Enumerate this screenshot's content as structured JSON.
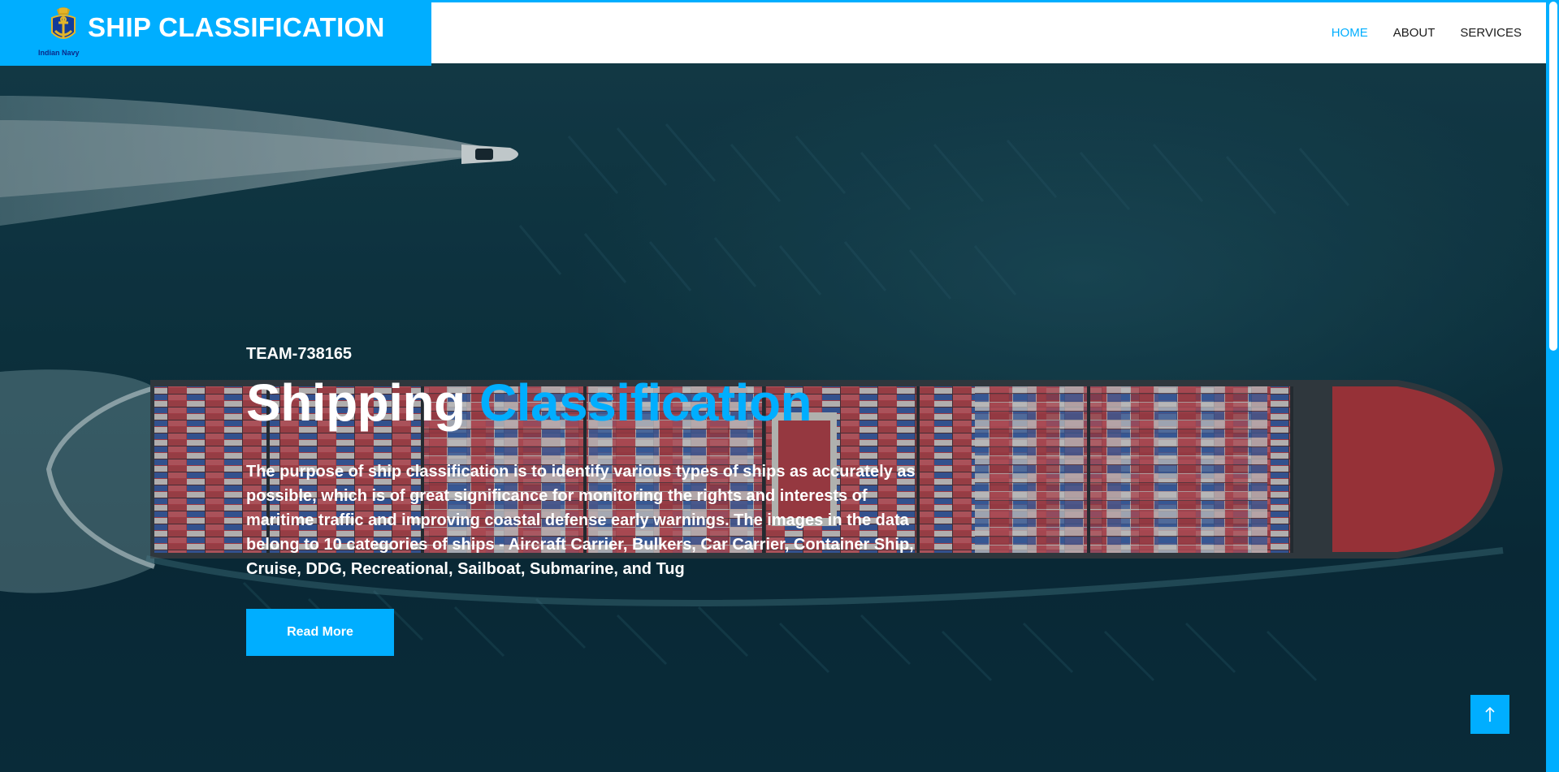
{
  "header": {
    "brand_title": "SHIP CLASSIFICATION",
    "emblem_caption": "Indian Navy",
    "nav": [
      {
        "label": "HOME",
        "active": true
      },
      {
        "label": "ABOUT",
        "active": false
      },
      {
        "label": "SERVICES",
        "active": false
      }
    ]
  },
  "hero": {
    "eyebrow": "TEAM-738165",
    "headline_part1": "Shipping ",
    "headline_accent": "Classification",
    "description": "The purpose of ship classification is to identify various types of ships as accurately as possible, which is of great significance for monitoring the rights and interests of maritime traffic and improving coastal defense early warnings. The images in the data belong to 10 categories of ships - Aircraft Carrier, Bulkers, Car Carrier, Container Ship, Cruise, DDG, Recreational, Sailboat, Submarine, and Tug",
    "cta_label": "Read More"
  },
  "back_to_top_icon": "arrow-up-icon",
  "colors": {
    "accent": "#00aeff",
    "header_bg": "#ffffff",
    "ocean": "#0d2f3d"
  }
}
